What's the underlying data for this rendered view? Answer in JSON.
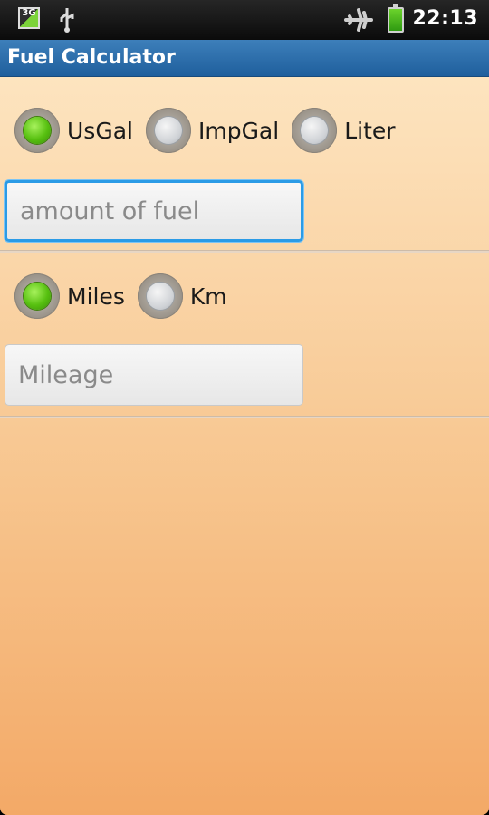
{
  "status_bar": {
    "time": "22:13",
    "network_label": "3G",
    "icons": [
      "3g-icon",
      "usb-icon",
      "airplane-mode-icon",
      "battery-charging-icon"
    ]
  },
  "title_bar": {
    "title": "Fuel Calculator",
    "background_color": "#2c6aa7"
  },
  "fuel_units": {
    "options": [
      {
        "label": "UsGal",
        "checked": true
      },
      {
        "label": "ImpGal",
        "checked": false
      },
      {
        "label": "Liter",
        "checked": false
      }
    ]
  },
  "fuel_input": {
    "placeholder": "amount of fuel",
    "value": ""
  },
  "distance_units": {
    "options": [
      {
        "label": "Miles",
        "checked": true
      },
      {
        "label": "Km",
        "checked": false
      }
    ]
  },
  "mileage_input": {
    "placeholder": "Mileage",
    "value": ""
  },
  "colors": {
    "accent_focus": "#2b9be6",
    "radio_checked": "#57c010",
    "background_top": "#fde4bf",
    "background_bottom": "#f3a967"
  }
}
